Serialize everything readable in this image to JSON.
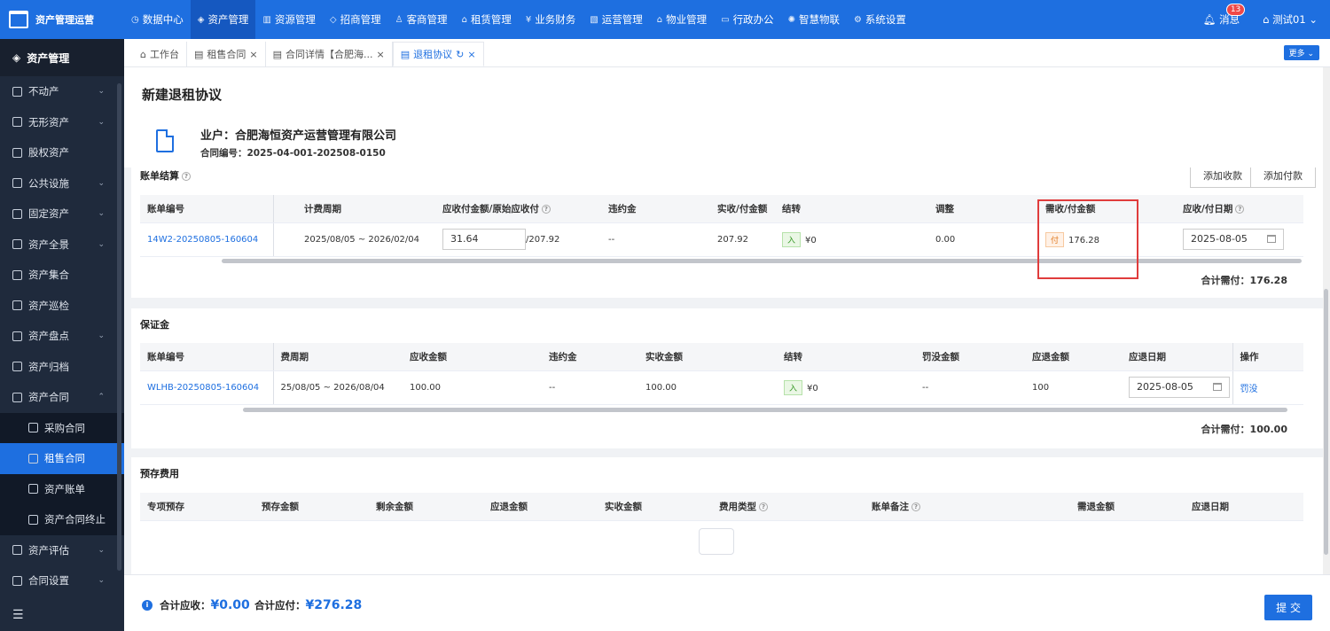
{
  "app": {
    "title": "资产管理运营"
  },
  "nav": [
    {
      "label": "数据中心",
      "icon": "dashboard-icon"
    },
    {
      "label": "资产管理",
      "icon": "cube-icon"
    },
    {
      "label": "资源管理",
      "icon": "building-icon"
    },
    {
      "label": "招商管理",
      "icon": "tag-icon"
    },
    {
      "label": "客商管理",
      "icon": "user-icon"
    },
    {
      "label": "租赁管理",
      "icon": "house-icon"
    },
    {
      "label": "业务财务",
      "icon": "yen-icon"
    },
    {
      "label": "运营管理",
      "icon": "chart-icon"
    },
    {
      "label": "物业管理",
      "icon": "property-icon"
    },
    {
      "label": "行政办公",
      "icon": "desk-icon"
    },
    {
      "label": "智慧物联",
      "icon": "iot-icon"
    },
    {
      "label": "系统设置",
      "icon": "gear-icon"
    }
  ],
  "user": {
    "messages_label": "消息",
    "messages_count": "13",
    "name": "测试01"
  },
  "sidebar": {
    "title": "资产管理",
    "items": [
      {
        "label": "不动产",
        "chevron": "⌄"
      },
      {
        "label": "无形资产",
        "chevron": "⌄"
      },
      {
        "label": "股权资产",
        "chevron": ""
      },
      {
        "label": "公共设施",
        "chevron": "⌄"
      },
      {
        "label": "固定资产",
        "chevron": "⌄"
      },
      {
        "label": "资产全景",
        "chevron": "⌄"
      },
      {
        "label": "资产集合",
        "chevron": ""
      },
      {
        "label": "资产巡检",
        "chevron": ""
      },
      {
        "label": "资产盘点",
        "chevron": "⌄"
      },
      {
        "label": "资产归档",
        "chevron": ""
      },
      {
        "label": "资产合同",
        "chevron": "⌃"
      }
    ],
    "subitems": [
      {
        "label": "采购合同"
      },
      {
        "label": "租售合同"
      },
      {
        "label": "资产账单"
      },
      {
        "label": "资产合同终止"
      }
    ],
    "items2": [
      {
        "label": "资产评估",
        "chevron": "⌄"
      },
      {
        "label": "合同设置",
        "chevron": "⌄"
      }
    ]
  },
  "tabs": [
    {
      "label": "工作台"
    },
    {
      "label": "租售合同"
    },
    {
      "label": "合同详情【合肥海..."
    },
    {
      "label": "退租协议"
    }
  ],
  "more_label": "更多 ⌄",
  "page": {
    "title": "新建退租协议",
    "org": "业户：合肥海恒资产运营管理有限公司",
    "contract_label": "合同编号：",
    "contract_no": "2025-04-001-202508-0150"
  },
  "bill": {
    "title": "账单结算",
    "add_receive": "添加收款",
    "add_pay": "添加付款",
    "headers": [
      "账单编号",
      "计费周期",
      "应收付金额/原始应收付",
      "违约金",
      "实收/付金额",
      "结转",
      "调整",
      "需收/付金额",
      "应收/付日期"
    ],
    "row": {
      "no": "14W2-20250805-160604",
      "period": "2025/08/05 ~ 2026/02/04",
      "amount": "31.64",
      "orig": "/207.92",
      "penalty": "--",
      "actual": "207.92",
      "carry_tag": "入",
      "carry": "¥0",
      "adjust": "0.00",
      "need_tag": "付",
      "need": "176.28",
      "date": "2025-08-05"
    },
    "total": "合计需付：176.28"
  },
  "deposit": {
    "title": "保证金",
    "headers": [
      "账单编号",
      "费周期",
      "应收金额",
      "违约金",
      "实收金额",
      "结转",
      "罚没金额",
      "应退金额",
      "应退日期",
      "操作"
    ],
    "row": {
      "no": "WLHB-20250805-160604",
      "period": "25/08/05 ~ 2026/08/04",
      "receivable": "100.00",
      "penalty": "--",
      "actual": "100.00",
      "carry_tag": "入",
      "carry": "¥0",
      "forfeit": "--",
      "refund": "100",
      "date": "2025-08-05",
      "action": "罚没"
    },
    "total": "合计需付：100.00"
  },
  "prestore": {
    "title": "预存费用",
    "headers": [
      "专项预存",
      "预存金额",
      "剩余金额",
      "应退金额",
      "实收金额",
      "费用类型",
      "账单备注",
      "需退金额",
      "应退日期"
    ]
  },
  "footer": {
    "recv_label": "合计应收：",
    "recv": "¥0.00",
    "pay_label": "合计应付：",
    "pay": "¥276.28",
    "submit": "提 交"
  }
}
